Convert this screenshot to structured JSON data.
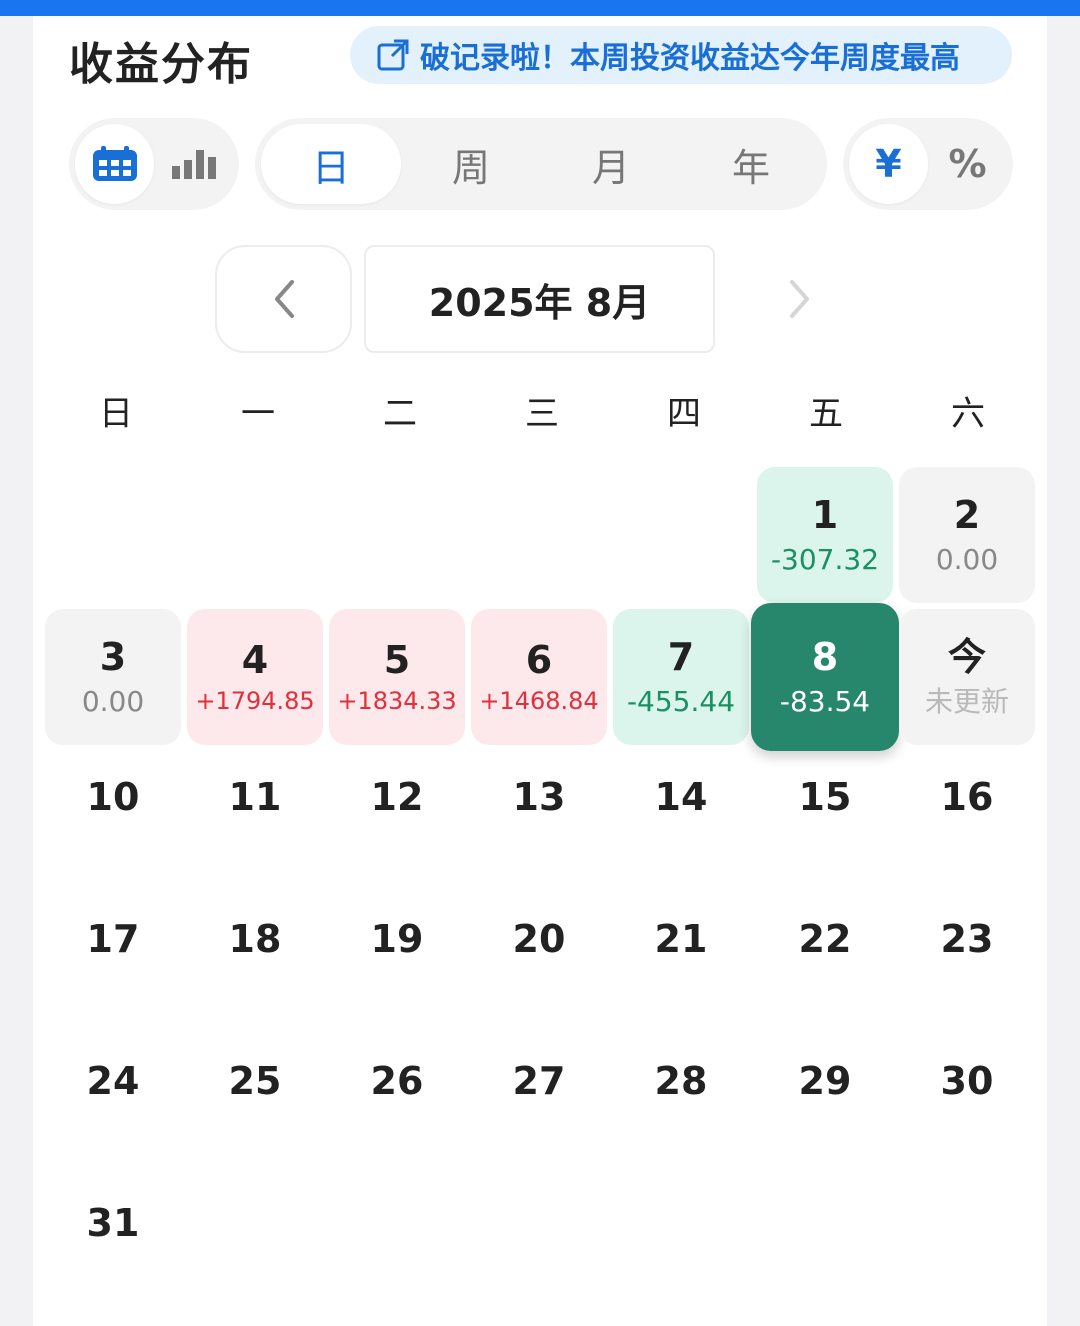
{
  "title": "收益分布",
  "banner": {
    "text": "破记录啦！本周投资收益达今年周度最高",
    "icon": "external-link-icon"
  },
  "view_toggle": [
    {
      "icon": "calendar-icon",
      "active": true
    },
    {
      "icon": "bar-chart-icon",
      "active": false
    }
  ],
  "period_tabs": [
    {
      "label": "日",
      "active": true
    },
    {
      "label": "周",
      "active": false
    },
    {
      "label": "月",
      "active": false
    },
    {
      "label": "年",
      "active": false
    }
  ],
  "unit_tabs": [
    {
      "label": "¥",
      "active": true
    },
    {
      "label": "%",
      "active": false
    }
  ],
  "month_label": "2025年 8月",
  "weekdays": [
    "日",
    "一",
    "二",
    "三",
    "四",
    "五",
    "六"
  ],
  "days": [
    {
      "day": "1",
      "value": "-307.32",
      "status": "loss"
    },
    {
      "day": "2",
      "value": "0.00",
      "status": "zero"
    },
    {
      "day": "3",
      "value": "0.00",
      "status": "zero"
    },
    {
      "day": "4",
      "value": "+1794.85",
      "status": "gain"
    },
    {
      "day": "5",
      "value": "+1834.33",
      "status": "gain"
    },
    {
      "day": "6",
      "value": "+1468.84",
      "status": "gain"
    },
    {
      "day": "7",
      "value": "-455.44",
      "status": "loss"
    },
    {
      "day": "8",
      "value": "-83.54",
      "status": "selected"
    },
    {
      "day": "今",
      "value": "未更新",
      "status": "pending"
    },
    {
      "day": "10"
    },
    {
      "day": "11"
    },
    {
      "day": "12"
    },
    {
      "day": "13"
    },
    {
      "day": "14"
    },
    {
      "day": "15"
    },
    {
      "day": "16"
    },
    {
      "day": "17"
    },
    {
      "day": "18"
    },
    {
      "day": "19"
    },
    {
      "day": "20"
    },
    {
      "day": "21"
    },
    {
      "day": "22"
    },
    {
      "day": "23"
    },
    {
      "day": "24"
    },
    {
      "day": "25"
    },
    {
      "day": "26"
    },
    {
      "day": "27"
    },
    {
      "day": "28"
    },
    {
      "day": "29"
    },
    {
      "day": "30"
    },
    {
      "day": "31"
    }
  ],
  "colors": {
    "accent": "#1a6fd6",
    "gain_text": "#e0303c",
    "gain_bg": "#fde9ec",
    "loss_text": "#1a9064",
    "loss_bg": "#dbf4ec",
    "selected_bg": "#27876c"
  }
}
